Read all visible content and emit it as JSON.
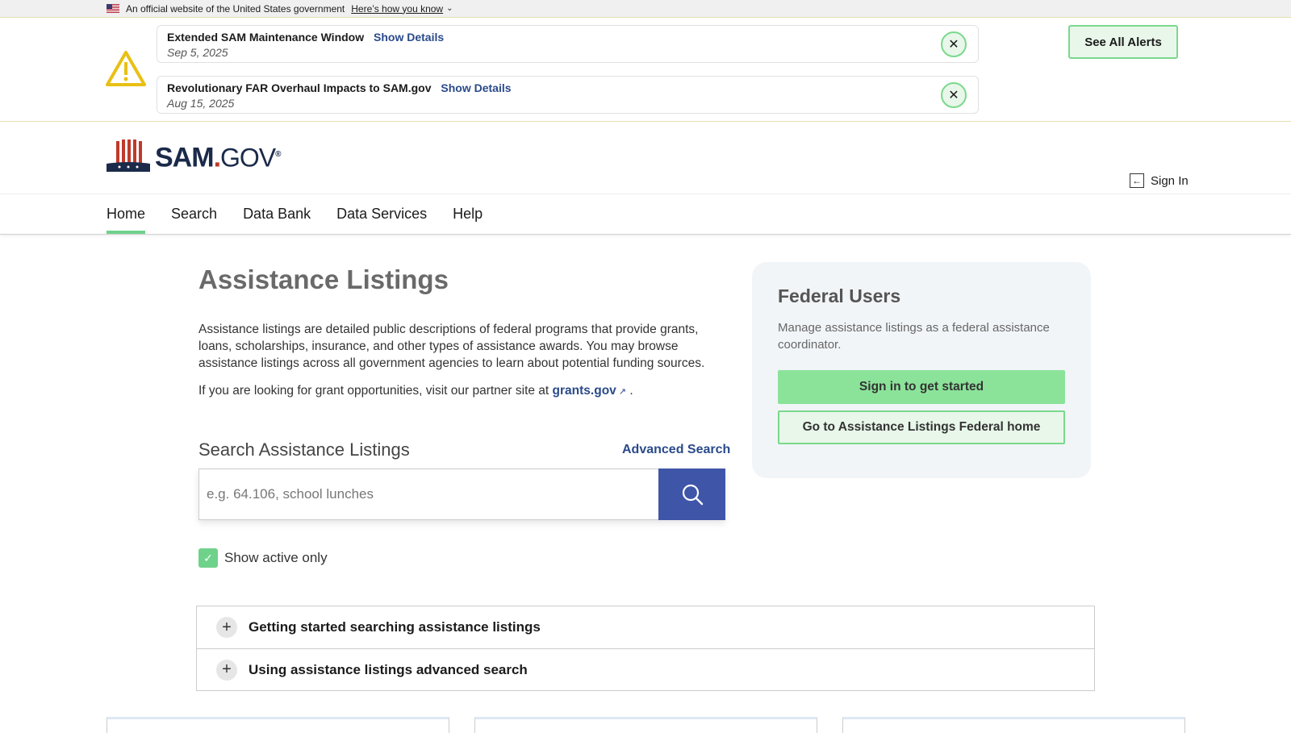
{
  "gov_banner": {
    "text": "An official website of the United States government",
    "link": "Here’s how you know"
  },
  "alerts": {
    "items": [
      {
        "title": "Extended SAM Maintenance Window",
        "details": "Show Details",
        "date": "Sep 5, 2025"
      },
      {
        "title": "Revolutionary FAR Overhaul Impacts to SAM.gov",
        "details": "Show Details",
        "date": "Aug 15, 2025"
      }
    ],
    "see_all": "See All Alerts"
  },
  "header": {
    "logo_sam": "SAM",
    "logo_dot": ".",
    "logo_gov": "GOV",
    "logo_reg": "®",
    "sign_in": "Sign In"
  },
  "nav": {
    "items": [
      "Home",
      "Search",
      "Data Bank",
      "Data Services",
      "Help"
    ],
    "active": "Home"
  },
  "main": {
    "title": "Assistance Listings",
    "description": "Assistance listings are detailed public descriptions of federal programs that provide grants, loans, scholarships, insurance, and other types of assistance awards. You may browse assistance listings across all government agencies to learn about potential funding sources.",
    "partner_text": "If you are looking for grant opportunities, visit our partner site at",
    "partner_link": "grants.gov",
    "partner_end": "."
  },
  "search": {
    "heading": "Search Assistance Listings",
    "advanced": "Advanced Search",
    "placeholder": "e.g. 64.106, school lunches",
    "value": "",
    "active_only_label": "Show active only",
    "active_only_checked": true
  },
  "federal": {
    "title": "Federal Users",
    "description": "Manage assistance listings as a federal assistance coordinator.",
    "btn_signin": "Sign in to get started",
    "btn_home": "Go to Assistance Listings Federal home"
  },
  "accordion": {
    "items": [
      "Getting started searching assistance listings",
      "Using assistance listings advanced search"
    ]
  },
  "colors": {
    "accent_green": "#6fd28a",
    "link_blue": "#2a4a8a",
    "search_button": "#3f55a8"
  }
}
